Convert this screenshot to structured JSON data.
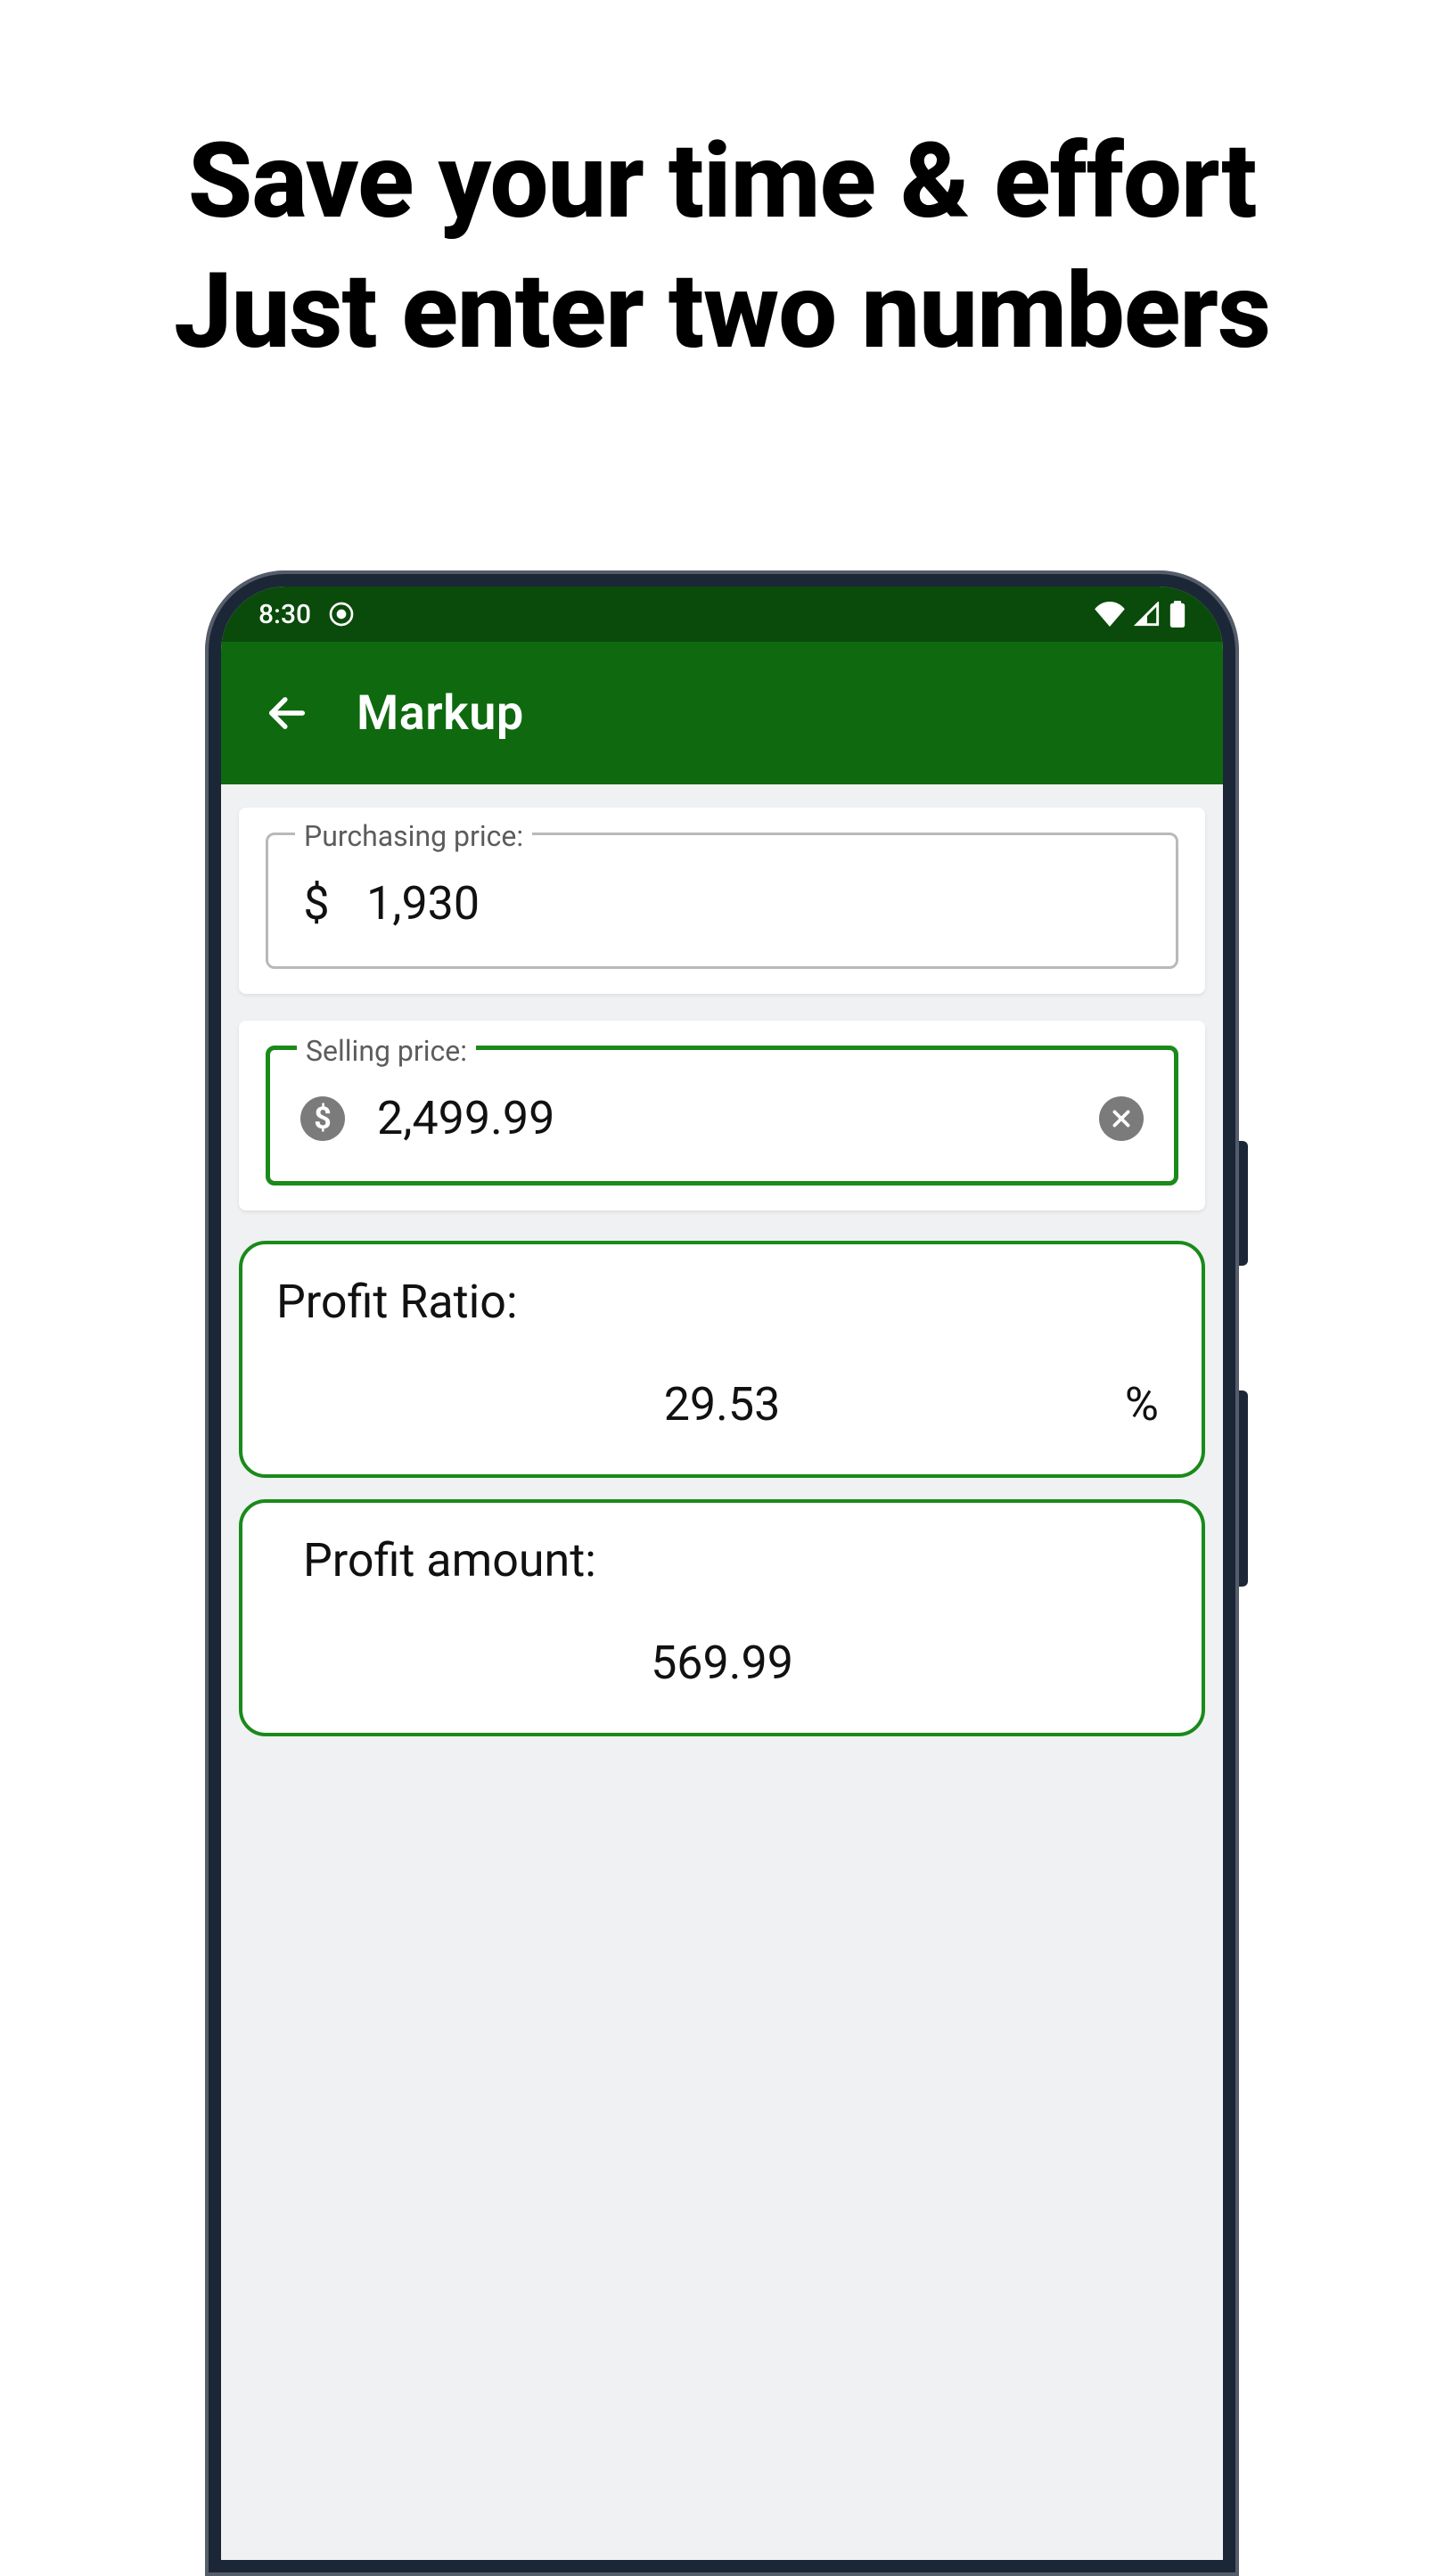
{
  "headline": {
    "line1": "Save your time & effort",
    "line2": "Just enter two numbers"
  },
  "statusbar": {
    "time": "8:30"
  },
  "appbar": {
    "title": "Markup"
  },
  "inputs": {
    "purchasing": {
      "label": "Purchasing price:",
      "currency_symbol": "$",
      "value": "1,930"
    },
    "selling": {
      "label": "Selling price:",
      "currency_symbol": "$",
      "value": "2,499.99"
    }
  },
  "results": {
    "profit_ratio": {
      "label": "Profit Ratio:",
      "value": "29.53",
      "unit": "%"
    },
    "profit_amount": {
      "label": "Profit amount:",
      "value": "569.99"
    }
  }
}
